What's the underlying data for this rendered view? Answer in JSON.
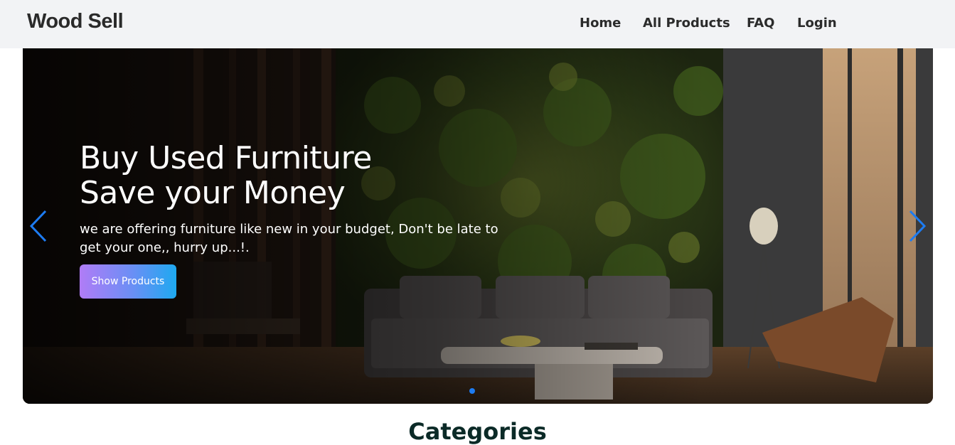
{
  "navbar": {
    "brand": "Wood Sell",
    "links": [
      "Home",
      "All Products",
      "FAQ",
      "Login"
    ]
  },
  "hero": {
    "title_line1": "Buy Used Furniture",
    "title_line2": "Save your Money",
    "subtitle": "we are offering furniture like new in your budget, Don't be late to get your one,, hurry up...!.",
    "button_label": "Show Products",
    "prev_icon": "chevron-left-icon",
    "next_icon": "chevron-right-icon",
    "active_slide": 1,
    "slide_count": 1
  },
  "categories": {
    "title": "Categories"
  },
  "colors": {
    "nav_bg": "#f2f3f5",
    "brand_text": "#2a2a2a",
    "arrow": "#1d7cf2",
    "dot_active": "#1d7cf2",
    "button_gradient_start": "#b07cf6",
    "button_gradient_end": "#1ea9f0",
    "categories_title": "#0b2a27"
  }
}
